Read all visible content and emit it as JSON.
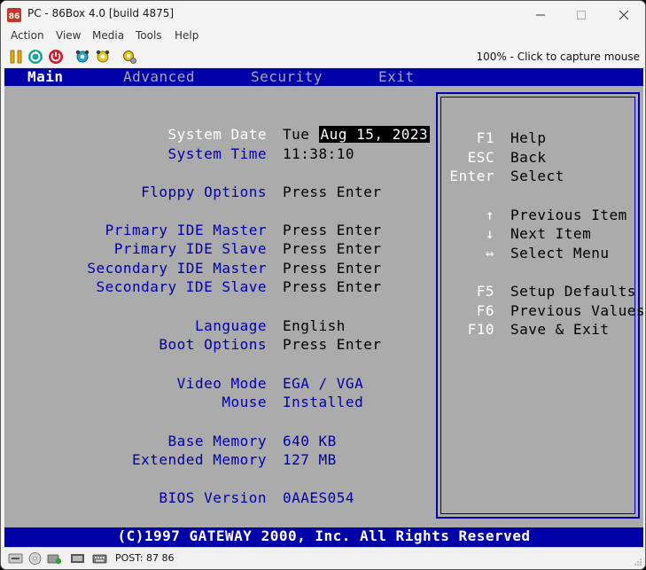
{
  "window": {
    "title": "PC - 86Box 4.0 [build 4875]"
  },
  "menubar": {
    "items": [
      "Action",
      "View",
      "Media",
      "Tools",
      "Help"
    ]
  },
  "toolbar": {
    "icons": [
      "pause-icon",
      "reset-icon",
      "power-icon",
      "settings-icon",
      "hard-reset-icon",
      "preferences-icon"
    ],
    "capture_text": "100% - Click to capture mouse"
  },
  "bios": {
    "tabs": [
      "Main",
      "Advanced",
      "Security",
      "Exit"
    ],
    "active_tab": "Main",
    "fields": [
      {
        "label": "System Date",
        "value_prefix": "Tue ",
        "value": "Aug 15, 2023"
      },
      {
        "label": "System Time",
        "value": "11:38:10"
      },
      {
        "label": "Floppy Options",
        "value": "Press Enter"
      },
      {
        "label": "Primary IDE Master",
        "value": "Press Enter"
      },
      {
        "label": "Primary IDE Slave",
        "value": "Press Enter"
      },
      {
        "label": "Secondary IDE Master",
        "value": "Press Enter"
      },
      {
        "label": "Secondary IDE Slave",
        "value": "Press Enter"
      },
      {
        "label": "Language",
        "value": "English"
      },
      {
        "label": "Boot Options",
        "value": "Press Enter"
      },
      {
        "label": "Video Mode",
        "value": "EGA / VGA"
      },
      {
        "label": "Mouse",
        "value": "Installed"
      },
      {
        "label": "Base Memory",
        "value": "640 KB"
      },
      {
        "label": "Extended Memory",
        "value": "127 MB"
      },
      {
        "label": "BIOS Version",
        "value": "0AAES054"
      }
    ],
    "help": [
      {
        "key": "F1",
        "desc": "Help"
      },
      {
        "key": "ESC",
        "desc": "Back"
      },
      {
        "key": "Enter",
        "desc": "Select"
      },
      {
        "key": "↑",
        "desc": "Previous Item"
      },
      {
        "key": "↓",
        "desc": "Next Item"
      },
      {
        "key": "↔",
        "desc": "Select Menu"
      },
      {
        "key": "F5",
        "desc": "Setup Defaults"
      },
      {
        "key": "F6",
        "desc": "Previous Values"
      },
      {
        "key": "F10",
        "desc": "Save & Exit"
      }
    ],
    "copyright": "(C)1997 GATEWAY 2000, Inc. All Rights Reserved",
    "colors": {
      "bar": "#0000a8",
      "screen_bg": "#ababab",
      "label": "#0000a8",
      "value": "#000000",
      "highlight_bg": "#000000",
      "highlight_fg": "#ffffff"
    }
  },
  "statusbar": {
    "icons": [
      "floppy-drive-icon",
      "cd-drive-icon",
      "hard-disk-icon",
      "network-icon",
      "keyboard-icon"
    ],
    "post_text": "POST: 87 86"
  }
}
